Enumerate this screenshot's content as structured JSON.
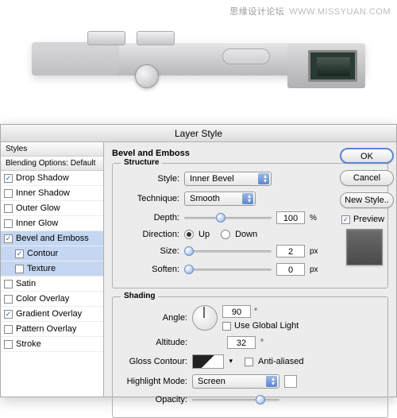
{
  "watermark": {
    "cn": "思缘设计论坛",
    "url": "WWW.MISSYUAN.COM"
  },
  "dialog": {
    "title": "Layer Style"
  },
  "sidebar": {
    "hdr1": "Styles",
    "hdr2": "Blending Options: Default",
    "items": [
      {
        "label": "Drop Shadow",
        "checked": true
      },
      {
        "label": "Inner Shadow",
        "checked": false
      },
      {
        "label": "Outer Glow",
        "checked": false
      },
      {
        "label": "Inner Glow",
        "checked": false
      },
      {
        "label": "Bevel and Emboss",
        "checked": true,
        "selected": true
      },
      {
        "label": "Contour",
        "checked": true,
        "sub": true,
        "selected": true
      },
      {
        "label": "Texture",
        "checked": false,
        "sub": true,
        "selected": true
      },
      {
        "label": "Satin",
        "checked": false
      },
      {
        "label": "Color Overlay",
        "checked": false
      },
      {
        "label": "Gradient Overlay",
        "checked": true
      },
      {
        "label": "Pattern Overlay",
        "checked": false
      },
      {
        "label": "Stroke",
        "checked": false
      }
    ]
  },
  "main": {
    "section": "Bevel and Emboss",
    "structure": {
      "legend": "Structure",
      "style_lbl": "Style:",
      "style_val": "Inner Bevel",
      "tech_lbl": "Technique:",
      "tech_val": "Smooth",
      "depth_lbl": "Depth:",
      "depth_val": "100",
      "depth_unit": "%",
      "dir_lbl": "Direction:",
      "up": "Up",
      "down": "Down",
      "size_lbl": "Size:",
      "size_val": "2",
      "size_unit": "px",
      "soften_lbl": "Soften:",
      "soften_val": "0",
      "soften_unit": "px"
    },
    "shading": {
      "legend": "Shading",
      "angle_lbl": "Angle:",
      "angle_val": "90",
      "global": "Use Global Light",
      "alt_lbl": "Altitude:",
      "alt_val": "32",
      "gloss_lbl": "Gloss Contour:",
      "aa": "Anti-aliased",
      "hmode_lbl": "Highlight Mode:",
      "hmode_val": "Screen",
      "opacity_lbl": "Opacity:"
    }
  },
  "buttons": {
    "ok": "OK",
    "cancel": "Cancel",
    "newstyle": "New Style..",
    "preview": "Preview"
  }
}
